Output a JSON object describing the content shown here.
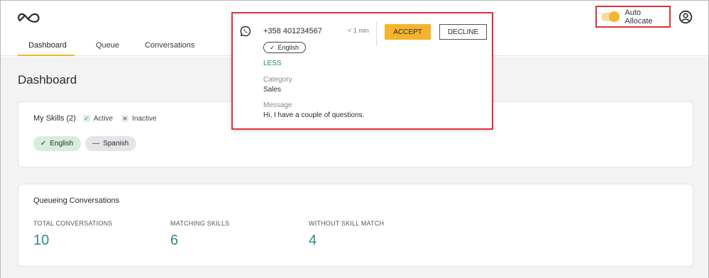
{
  "header": {
    "tabs": [
      {
        "label": "Dashboard",
        "active": true
      },
      {
        "label": "Queue",
        "active": false
      },
      {
        "label": "Conversations",
        "active": false
      }
    ],
    "auto_allocate": {
      "label": "Auto Allocate",
      "enabled": true
    },
    "accent_color": "#f5b32e"
  },
  "main": {
    "title": "Dashboard",
    "skills": {
      "title": "My Skills (2)",
      "legend_active": "Active",
      "legend_inactive": "Inactive",
      "chips": [
        {
          "label": "English",
          "state": "active",
          "icon": "check-icon"
        },
        {
          "label": "Spanish",
          "state": "inactive",
          "icon": "minus-icon"
        }
      ]
    },
    "queue": {
      "title": "Queueing Conversations",
      "stats": [
        {
          "label": "TOTAL CONVERSATIONS",
          "value": "10"
        },
        {
          "label": "MATCHING SKILLS",
          "value": "6"
        },
        {
          "label": "WITHOUT SKILL MATCH",
          "value": "4"
        }
      ]
    }
  },
  "popup": {
    "channel_icon": "whatsapp-icon",
    "phone": "+358 401234567",
    "time": "< 1 min",
    "accept_label": "ACCEPT",
    "decline_label": "DECLINE",
    "language": "English",
    "less_label": "LESS",
    "category_label": "Category",
    "category_value": "Sales",
    "message_label": "Message",
    "message_value": "Hi, I have a couple of questions."
  }
}
